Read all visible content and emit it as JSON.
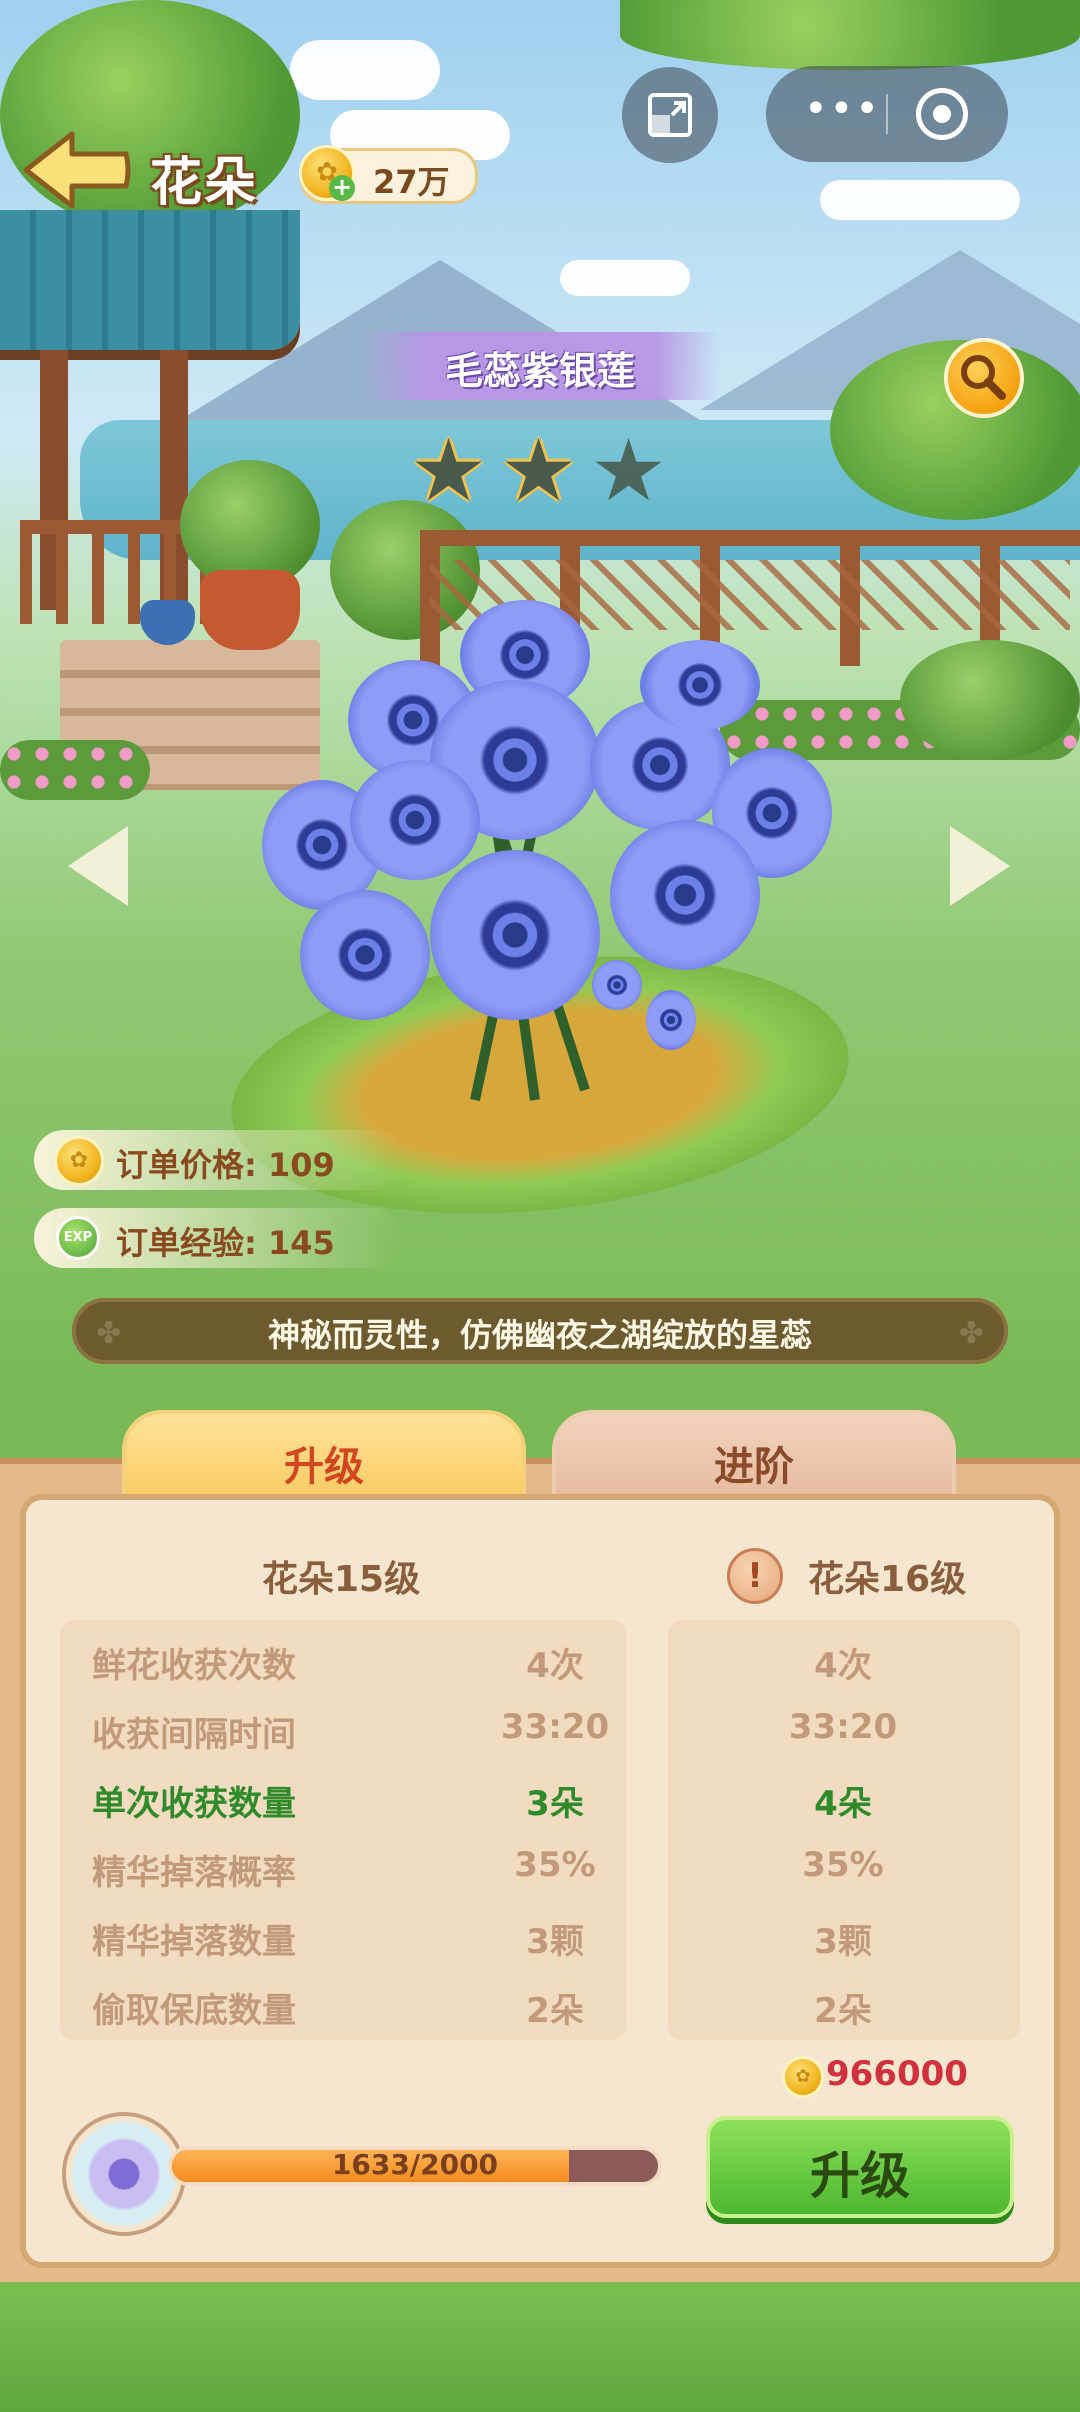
{
  "header": {
    "title": "花朵",
    "coins": "27万"
  },
  "flower": {
    "name": "毛蕊紫银莲",
    "stars_filled": 2,
    "stars_total": 3,
    "description": "神秘而灵性，仿佛幽夜之湖绽放的星蕊"
  },
  "orders": {
    "price_label": "订单价格: 109",
    "exp_label": "订单经验: 145",
    "exp_icon_text": "EXP"
  },
  "tabs": {
    "upgrade": "升级",
    "advance": "进阶"
  },
  "levels": {
    "current": "花朵15级",
    "next": "花朵16级",
    "warning_symbol": "!"
  },
  "stats": {
    "rows": [
      {
        "label": "鲜花收获次数",
        "current": "4次",
        "next": "4次",
        "highlight": false
      },
      {
        "label": "收获间隔时间",
        "current": "33:20",
        "next": "33:20",
        "highlight": false
      },
      {
        "label": "单次收获数量",
        "current": "3朵",
        "next": "4朵",
        "highlight": true
      },
      {
        "label": "精华掉落概率",
        "current": "35%",
        "next": "35%",
        "highlight": false
      },
      {
        "label": "精华掉落数量",
        "current": "3颗",
        "next": "3颗",
        "highlight": false
      },
      {
        "label": "偷取保底数量",
        "current": "2朵",
        "next": "2朵",
        "highlight": false
      }
    ]
  },
  "upgrade": {
    "cost": "966000",
    "progress_text": "1633/2000",
    "progress_value": 1633,
    "progress_max": 2000,
    "button_label": "升级"
  },
  "colors": {
    "highlight": "#2f8a2a",
    "stat_text": "#c39a79",
    "cost": "#d0313d",
    "button": "#4cb830"
  },
  "icons": [
    "back-arrow-icon",
    "coin-icon",
    "plus-icon",
    "expand-icon",
    "more-icon",
    "target-icon",
    "search-icon",
    "star-icon",
    "left-arrow-icon",
    "right-arrow-icon",
    "exp-icon",
    "warning-icon",
    "clover-icon"
  ]
}
